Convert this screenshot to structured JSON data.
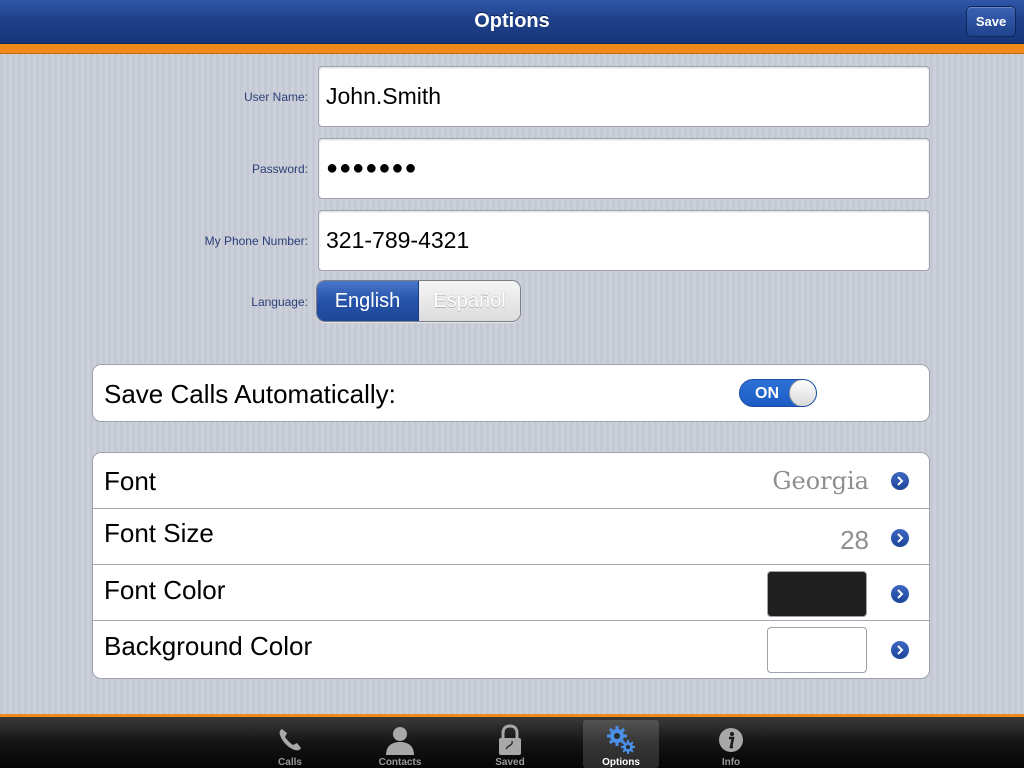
{
  "navbar": {
    "title": "Options",
    "save_label": "Save"
  },
  "form": {
    "username": {
      "label": "User Name:",
      "value": "John.Smith"
    },
    "password": {
      "label": "Password:",
      "value": "●●●●●●●"
    },
    "phone": {
      "label": "My Phone Number:",
      "value": "321-789-4321"
    },
    "language": {
      "label": "Language:",
      "options": [
        "English",
        "Español"
      ],
      "selected": "English"
    }
  },
  "save_calls": {
    "label": "Save Calls Automatically:",
    "toggle_text": "ON",
    "enabled": true
  },
  "font_settings": {
    "font": {
      "label": "Font",
      "value": "Georgia"
    },
    "font_size": {
      "label": "Font Size",
      "value": "28"
    },
    "font_color": {
      "label": "Font Color",
      "swatch": "#1f1f1f"
    },
    "background_color": {
      "label": "Background Color",
      "swatch": "#ffffff"
    }
  },
  "colors": {
    "navbar": "#1e3f88",
    "accent_orange": "#f08a1c",
    "toggle_on": "#2e71d6"
  },
  "tabbar": {
    "tabs": [
      {
        "label": "Calls",
        "icon": "phone-icon"
      },
      {
        "label": "Contacts",
        "icon": "person-icon"
      },
      {
        "label": "Saved",
        "icon": "lock-icon"
      },
      {
        "label": "Options",
        "icon": "gears-icon"
      },
      {
        "label": "Info",
        "icon": "info-icon"
      }
    ],
    "active": "Options"
  }
}
